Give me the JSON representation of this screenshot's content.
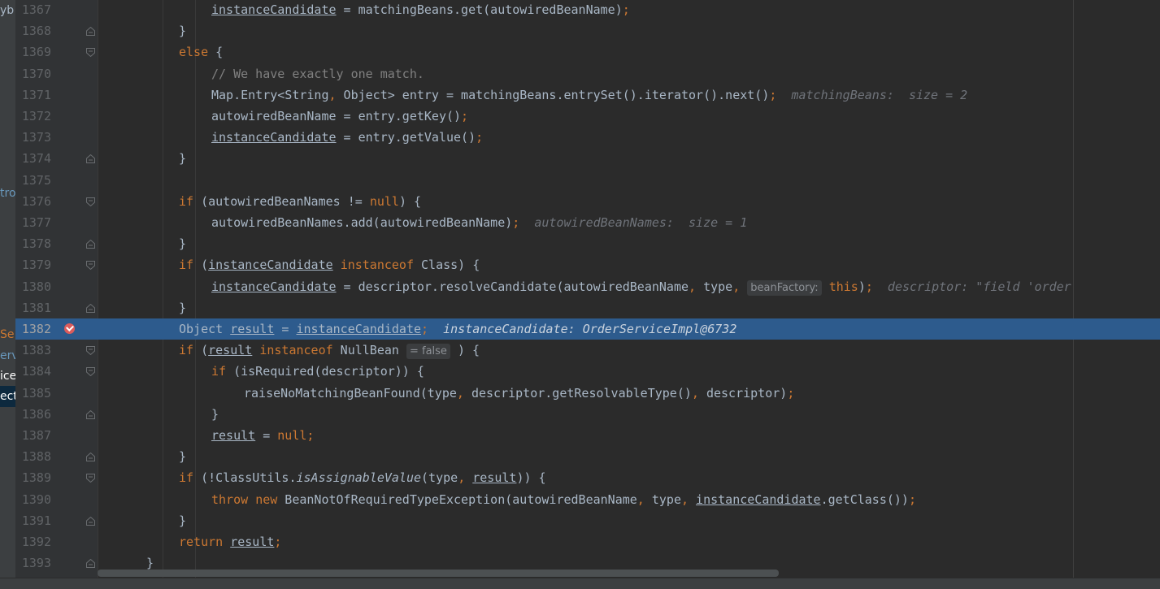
{
  "left_panel": [
    {
      "text": "yb",
      "color": "#a9b7c6",
      "bg": ""
    },
    {
      "text": "tro",
      "color": "#6897bb",
      "bg": ""
    },
    {
      "text": "Se",
      "color": "#cc7832",
      "bg": ""
    },
    {
      "text": "erv",
      "color": "#6897bb",
      "bg": ""
    },
    {
      "text": "ice",
      "color": "#ffffff",
      "bg": ""
    },
    {
      "text": "ect",
      "color": "#ffffff",
      "bg": "#0d293e"
    }
  ],
  "editor": {
    "lines": [
      {
        "num": "1367",
        "fold": "none",
        "indent": 260,
        "tokens": [
          [
            "instanceCandidate",
            "u"
          ],
          [
            " = matchingBeans.get(autowiredBeanName)",
            ""
          ],
          [
            ";",
            "k"
          ]
        ]
      },
      {
        "num": "1368",
        "fold": "close",
        "indent": 220,
        "tokens": [
          [
            "}",
            ""
          ]
        ]
      },
      {
        "num": "1369",
        "fold": "open",
        "indent": 220,
        "tokens": [
          [
            "else",
            "k"
          ],
          [
            " {",
            ""
          ]
        ]
      },
      {
        "num": "1370",
        "fold": "none",
        "indent": 260,
        "tokens": [
          [
            "// We have exactly one match.",
            "c"
          ]
        ]
      },
      {
        "num": "1371",
        "fold": "none",
        "indent": 260,
        "tokens": [
          [
            "Map.Entry<String",
            ""
          ],
          [
            ",",
            "k"
          ],
          [
            " Object> entry = matchingBeans.entrySet().iterator().next()",
            ""
          ],
          [
            ";",
            "k"
          ],
          [
            "  matchingBeans:  size = 2",
            "hint"
          ]
        ]
      },
      {
        "num": "1372",
        "fold": "none",
        "indent": 260,
        "tokens": [
          [
            "autowiredBeanName = entry.getKey()",
            ""
          ],
          [
            ";",
            "k"
          ]
        ]
      },
      {
        "num": "1373",
        "fold": "none",
        "indent": 260,
        "tokens": [
          [
            "instanceCandidate",
            "u"
          ],
          [
            " = entry.getValue()",
            ""
          ],
          [
            ";",
            "k"
          ]
        ]
      },
      {
        "num": "1374",
        "fold": "close",
        "indent": 220,
        "tokens": [
          [
            "}",
            ""
          ]
        ]
      },
      {
        "num": "1375",
        "fold": "none",
        "indent": 220,
        "tokens": []
      },
      {
        "num": "1376",
        "fold": "open",
        "indent": 220,
        "tokens": [
          [
            "if",
            "k"
          ],
          [
            " (autowiredBeanNames != ",
            ""
          ],
          [
            "null",
            "k"
          ],
          [
            ") {",
            ""
          ]
        ]
      },
      {
        "num": "1377",
        "fold": "none",
        "indent": 260,
        "tokens": [
          [
            "autowiredBeanNames.add(autowiredBeanName)",
            ""
          ],
          [
            ";",
            "k"
          ],
          [
            "  autowiredBeanNames:  size = 1",
            "hint"
          ]
        ]
      },
      {
        "num": "1378",
        "fold": "close",
        "indent": 220,
        "tokens": [
          [
            "}",
            ""
          ]
        ]
      },
      {
        "num": "1379",
        "fold": "open",
        "indent": 220,
        "tokens": [
          [
            "if",
            "k"
          ],
          [
            " (",
            ""
          ],
          [
            "instanceCandidate",
            "u"
          ],
          [
            " ",
            ""
          ],
          [
            "instanceof",
            "k"
          ],
          [
            " Class) {",
            ""
          ]
        ]
      },
      {
        "num": "1380",
        "fold": "none",
        "indent": 260,
        "tokens": [
          [
            "instanceCandidate",
            "u"
          ],
          [
            " = descriptor.resolveCandidate(autowiredBeanName",
            ""
          ],
          [
            ",",
            "k"
          ],
          [
            " type",
            ""
          ],
          [
            ",",
            "k"
          ],
          [
            " ",
            ""
          ],
          [
            "beanFactory:",
            "chip"
          ],
          [
            " ",
            ""
          ],
          [
            "this",
            "k"
          ],
          [
            ")",
            ""
          ],
          [
            ";",
            "k"
          ],
          [
            "  descriptor: \"field 'order",
            "hint"
          ]
        ]
      },
      {
        "num": "1381",
        "fold": "close",
        "indent": 220,
        "tokens": [
          [
            "}",
            ""
          ]
        ]
      },
      {
        "num": "1382",
        "fold": "none",
        "bp": true,
        "exec": true,
        "indent": 220,
        "tokens": [
          [
            "Object ",
            ""
          ],
          [
            "result",
            "u"
          ],
          [
            " = ",
            ""
          ],
          [
            "instanceCandidate",
            "u"
          ],
          [
            ";",
            "k"
          ],
          [
            "  instanceCandidate: OrderServiceImpl@6732",
            "hint"
          ]
        ]
      },
      {
        "num": "1383",
        "fold": "open",
        "indent": 220,
        "tokens": [
          [
            "if",
            "k"
          ],
          [
            " (",
            ""
          ],
          [
            "result",
            "u"
          ],
          [
            " ",
            ""
          ],
          [
            "instanceof",
            "k"
          ],
          [
            " NullBean ",
            ""
          ],
          [
            "= false",
            "chip"
          ],
          [
            " ) {",
            ""
          ]
        ]
      },
      {
        "num": "1384",
        "fold": "open",
        "indent": 260,
        "tokens": [
          [
            "if",
            "k"
          ],
          [
            " (isRequired(descriptor)) {",
            ""
          ]
        ]
      },
      {
        "num": "1385",
        "fold": "none",
        "indent": 300,
        "tokens": [
          [
            "raiseNoMatchingBeanFound(type",
            ""
          ],
          [
            ",",
            "k"
          ],
          [
            " descriptor.getResolvableType()",
            ""
          ],
          [
            ",",
            "k"
          ],
          [
            " descriptor)",
            ""
          ],
          [
            ";",
            "k"
          ]
        ]
      },
      {
        "num": "1386",
        "fold": "close",
        "indent": 260,
        "tokens": [
          [
            "}",
            ""
          ]
        ]
      },
      {
        "num": "1387",
        "fold": "none",
        "indent": 260,
        "tokens": [
          [
            "result",
            "u"
          ],
          [
            " = ",
            ""
          ],
          [
            "null",
            "k"
          ],
          [
            ";",
            "k"
          ]
        ]
      },
      {
        "num": "1388",
        "fold": "close",
        "indent": 220,
        "tokens": [
          [
            "}",
            ""
          ]
        ]
      },
      {
        "num": "1389",
        "fold": "open",
        "indent": 220,
        "tokens": [
          [
            "if",
            "k"
          ],
          [
            " (!ClassUtils.",
            ""
          ],
          [
            "isAssignableValue",
            "it"
          ],
          [
            "(type",
            ""
          ],
          [
            ",",
            "k"
          ],
          [
            " ",
            ""
          ],
          [
            "result",
            "u"
          ],
          [
            ")) {",
            ""
          ]
        ]
      },
      {
        "num": "1390",
        "fold": "none",
        "indent": 260,
        "tokens": [
          [
            "throw",
            "k"
          ],
          [
            " ",
            ""
          ],
          [
            "new",
            "k"
          ],
          [
            " BeanNotOfRequiredTypeException(autowiredBeanName",
            ""
          ],
          [
            ",",
            "k"
          ],
          [
            " type",
            ""
          ],
          [
            ",",
            "k"
          ],
          [
            " ",
            ""
          ],
          [
            "instanceCandidate",
            "u"
          ],
          [
            ".getClass())",
            ""
          ],
          [
            ";",
            "k"
          ]
        ]
      },
      {
        "num": "1391",
        "fold": "close",
        "indent": 220,
        "tokens": [
          [
            "}",
            ""
          ]
        ]
      },
      {
        "num": "1392",
        "fold": "none",
        "indent": 220,
        "tokens": [
          [
            "return",
            "k"
          ],
          [
            " ",
            ""
          ],
          [
            "result",
            "u"
          ],
          [
            ";",
            "k"
          ]
        ]
      },
      {
        "num": "1393",
        "fold": "close",
        "indent": 180,
        "tokens": [
          [
            "}",
            ""
          ]
        ]
      }
    ]
  },
  "colors": {
    "background": "#2b2b2b",
    "gutter": "#313335",
    "execution_line": "#2d5b8d",
    "keyword": "#cc7832",
    "comment": "#808080",
    "text": "#a9b7c6",
    "inline_hint": "#6f737a",
    "breakpoint": "#db5c5c"
  }
}
